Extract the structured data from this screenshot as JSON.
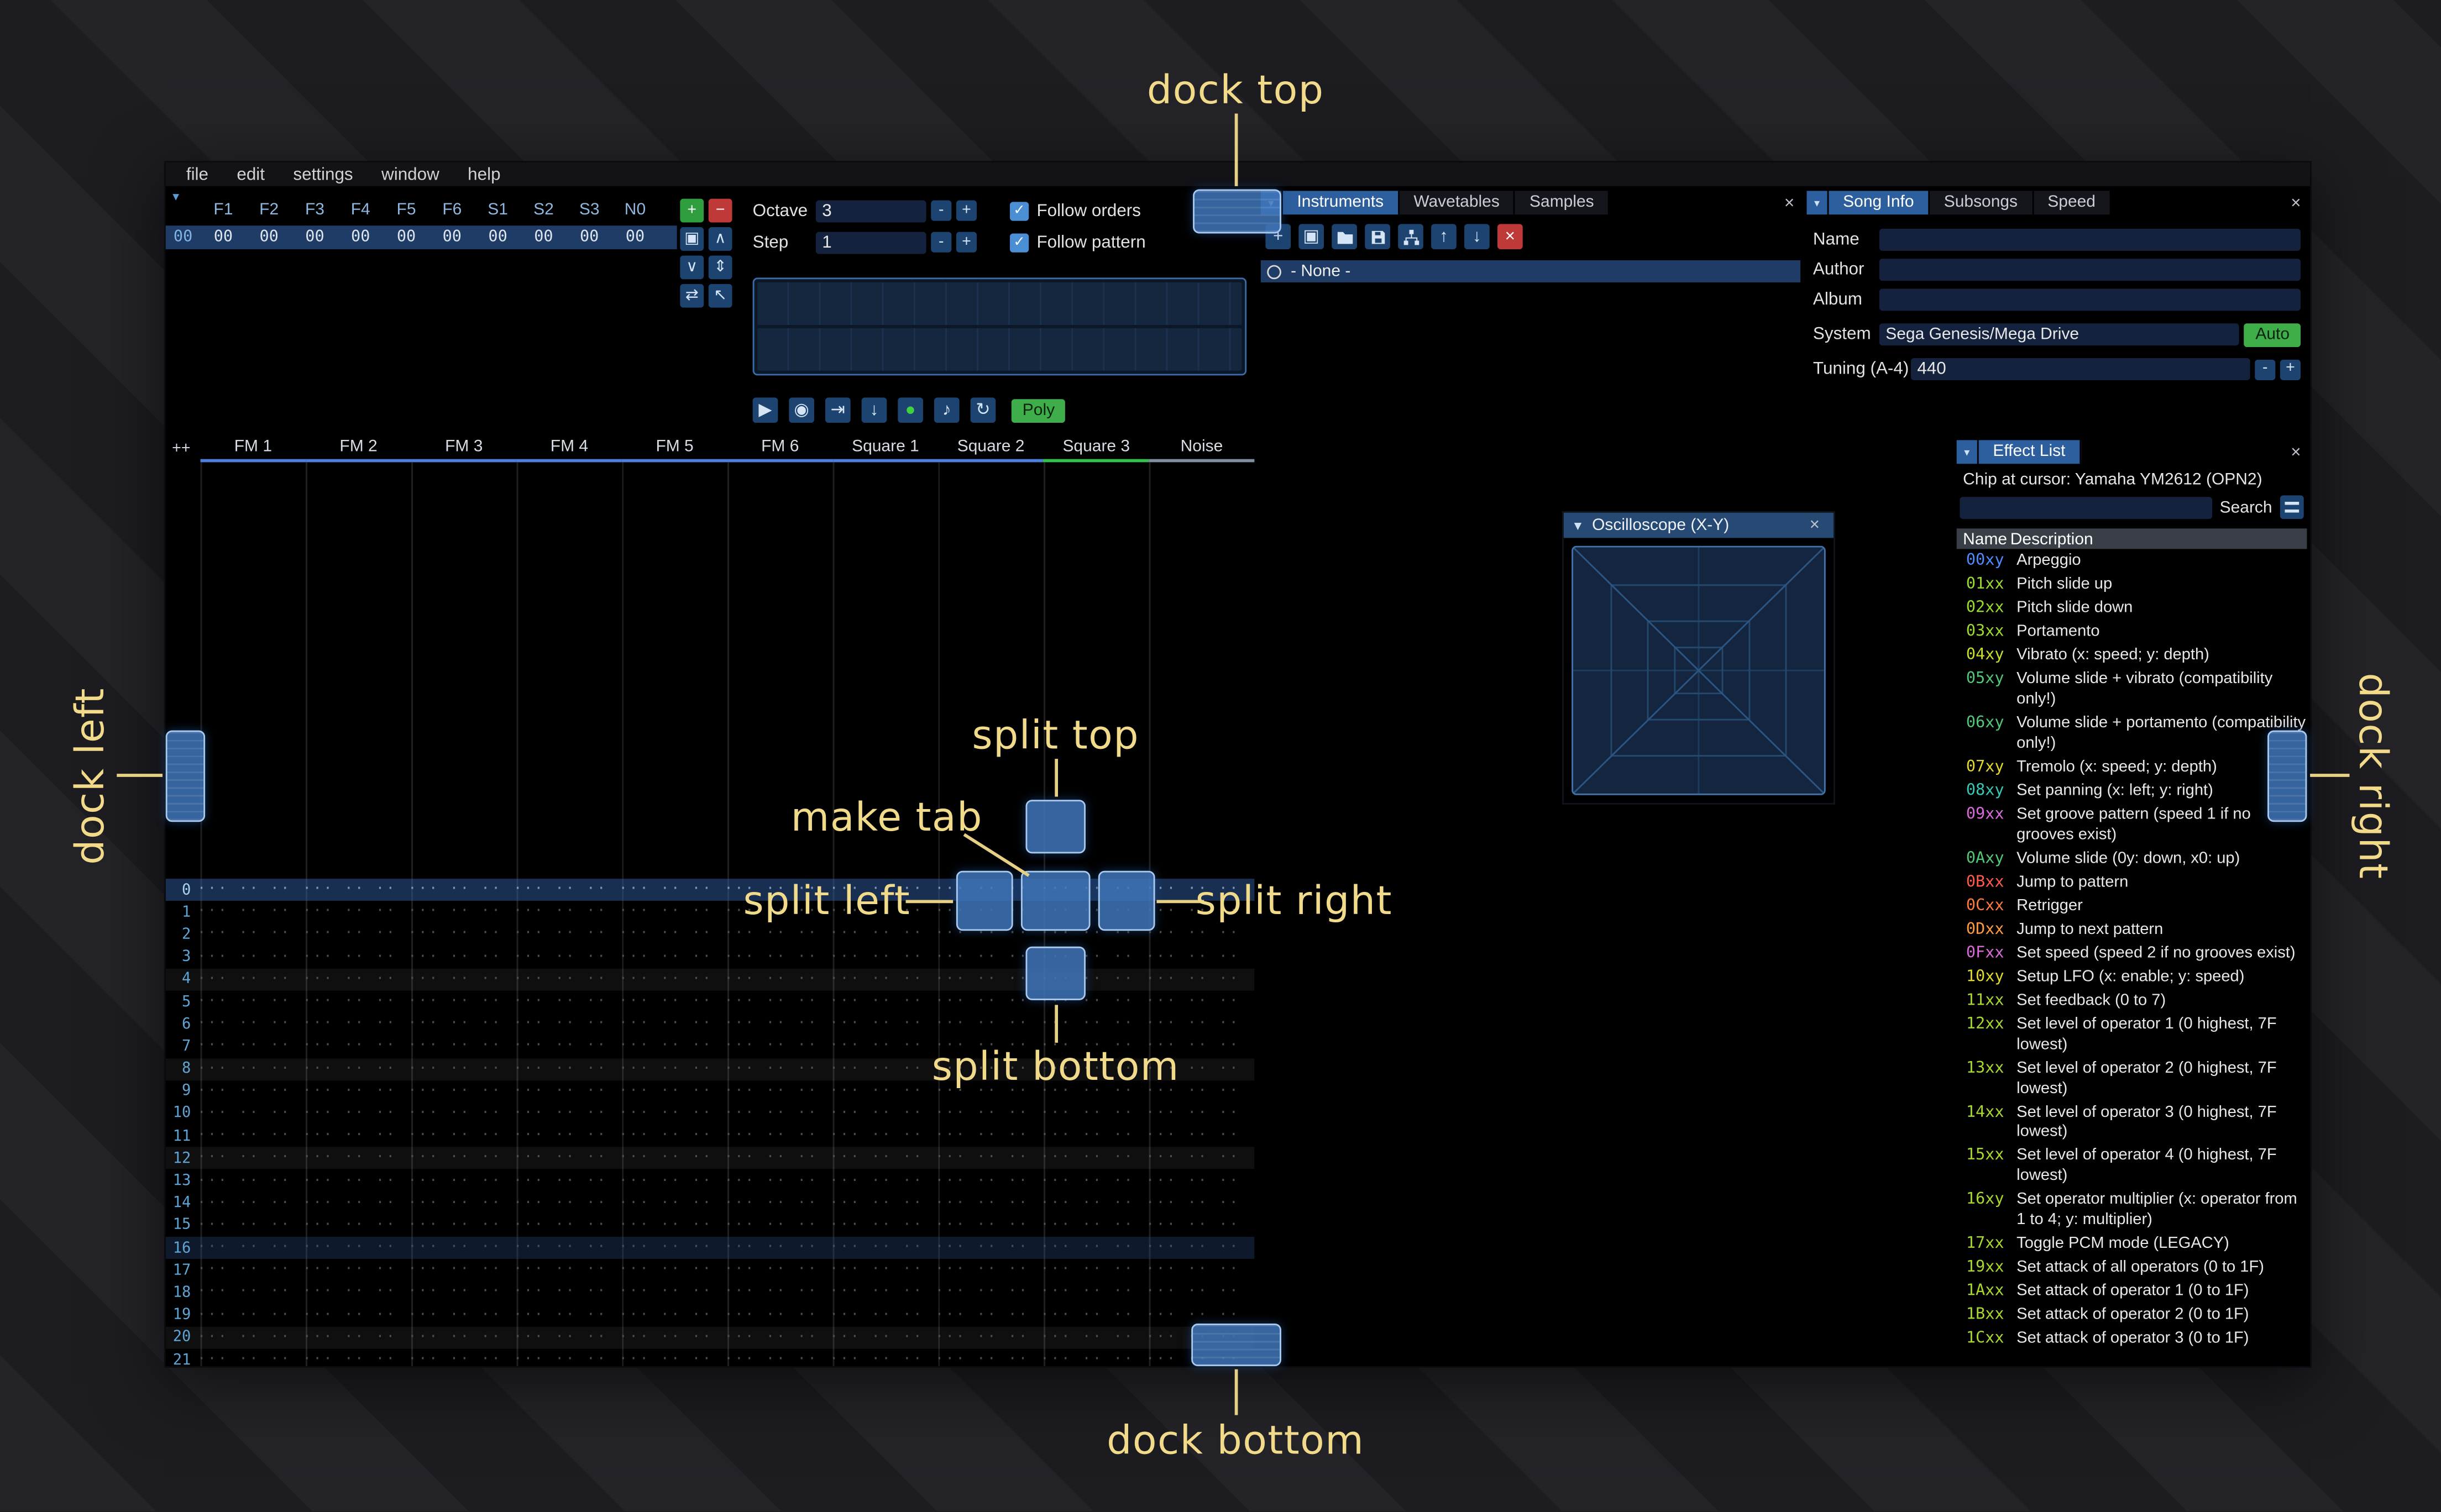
{
  "icons": {
    "close": "×",
    "collapse": "▼",
    "menu": "▾",
    "check": "✓",
    "plus": "+",
    "minus": "-"
  },
  "menu": {
    "items": [
      {
        "label": "file"
      },
      {
        "label": "edit"
      },
      {
        "label": "settings"
      },
      {
        "label": "window"
      },
      {
        "label": "help"
      }
    ]
  },
  "orders": {
    "channels": [
      "F1",
      "F2",
      "F3",
      "F4",
      "F5",
      "F6",
      "S1",
      "S2",
      "S3",
      "N0"
    ],
    "rows": [
      {
        "num": "00",
        "values": [
          "00",
          "00",
          "00",
          "00",
          "00",
          "00",
          "00",
          "00",
          "00",
          "00"
        ],
        "selected": true
      }
    ],
    "buttons": [
      {
        "name": "add-order",
        "glyph": "+",
        "style": "green"
      },
      {
        "name": "remove-order",
        "glyph": "−",
        "style": "red"
      },
      {
        "name": "duplicate-order",
        "glyph": "▣",
        "style": "blue"
      },
      {
        "name": "move-order-up",
        "glyph": "∧",
        "style": "blue"
      },
      {
        "name": "move-order-down",
        "glyph": "∨",
        "style": "blue"
      },
      {
        "name": "order-change-all",
        "glyph": "⇕",
        "style": "blue"
      },
      {
        "name": "order-deep-clone",
        "glyph": "⇄",
        "style": "blue"
      },
      {
        "name": "order-edit-mode",
        "glyph": "↖",
        "style": "blue"
      }
    ]
  },
  "play_controls": {
    "octave_label": "Octave",
    "octave_value": "3",
    "step_label": "Step",
    "step_value": "1",
    "follow_orders_label": "Follow orders",
    "follow_orders_checked": true,
    "follow_pattern_label": "Follow pattern",
    "follow_pattern_checked": true,
    "buttons": [
      {
        "name": "play",
        "glyph": "▶"
      },
      {
        "name": "play-from-start",
        "glyph": "◉"
      },
      {
        "name": "play-one-row",
        "glyph": "⇥"
      },
      {
        "name": "step-row",
        "glyph": "↓"
      },
      {
        "name": "edit-toggle",
        "glyph": "●",
        "style": "record"
      },
      {
        "name": "metronome",
        "glyph": "♪"
      },
      {
        "name": "repeat-pattern",
        "glyph": "↻"
      }
    ],
    "poly_label": "Poly"
  },
  "instruments": {
    "tabs": [
      {
        "label": "Instruments",
        "selected": true
      },
      {
        "label": "Wavetables",
        "selected": false
      },
      {
        "label": "Samples",
        "selected": false
      }
    ],
    "toolbar": [
      {
        "name": "add-instrument",
        "glyph": "+",
        "style": "blue"
      },
      {
        "name": "duplicate-instrument",
        "glyph": "▣",
        "style": "blue"
      },
      {
        "name": "open-instrument",
        "icon": "folder",
        "style": "blue"
      },
      {
        "name": "save-instrument",
        "icon": "floppy",
        "style": "blue"
      },
      {
        "name": "instrument-organizer",
        "icon": "sitemap",
        "style": "blue"
      },
      {
        "name": "move-instrument-up",
        "glyph": "↑",
        "style": "blue"
      },
      {
        "name": "move-instrument-down",
        "glyph": "↓",
        "style": "blue"
      },
      {
        "name": "delete-instrument",
        "glyph": "×",
        "style": "red"
      }
    ],
    "list": [
      {
        "label": "- None -",
        "selected": true
      }
    ]
  },
  "song_info": {
    "tabs": [
      {
        "label": "Song Info",
        "selected": true
      },
      {
        "label": "Subsongs",
        "selected": false
      },
      {
        "label": "Speed",
        "selected": false
      }
    ],
    "name_label": "Name",
    "name_value": "",
    "author_label": "Author",
    "author_value": "",
    "album_label": "Album",
    "album_value": "",
    "system_label": "System",
    "system_value": "Sega Genesis/Mega Drive",
    "auto_label": "Auto",
    "tuning_label": "Tuning (A-4)",
    "tuning_value": "440"
  },
  "pattern": {
    "corner_label": "++",
    "channels": [
      {
        "name": "FM 1",
        "color": "#4d7fe0"
      },
      {
        "name": "FM 2",
        "color": "#4d7fe0"
      },
      {
        "name": "FM 3",
        "color": "#4d7fe0"
      },
      {
        "name": "FM 4",
        "color": "#4d7fe0"
      },
      {
        "name": "FM 5",
        "color": "#4d7fe0"
      },
      {
        "name": "FM 6",
        "color": "#4d7fe0"
      },
      {
        "name": "Square 1",
        "color": "#4d7fe0"
      },
      {
        "name": "Square 2",
        "color": "#4d7fe0"
      },
      {
        "name": "Square 3",
        "color": "#35c04d"
      },
      {
        "name": "Noise",
        "color": "#7f8ea0"
      }
    ],
    "row_count": 22,
    "cell_placeholder": "··· ·· ·· ····"
  },
  "oscilloscope": {
    "title": "Oscilloscope (X-Y)"
  },
  "effect_list": {
    "tab_label": "Effect List",
    "chip_label": "Chip at cursor: Yamaha YM2612 (OPN2)",
    "search_label": "Search",
    "columns": {
      "name": "Name",
      "description": "Description"
    },
    "rows": [
      {
        "code": "00xy",
        "color": "#4e8bff",
        "desc": "Arpeggio"
      },
      {
        "code": "01xx",
        "color": "#9bdc2a",
        "desc": "Pitch slide up"
      },
      {
        "code": "02xx",
        "color": "#9bdc2a",
        "desc": "Pitch slide down"
      },
      {
        "code": "03xx",
        "color": "#9bdc2a",
        "desc": "Portamento"
      },
      {
        "code": "04xy",
        "color": "#c8dc2a",
        "desc": "Vibrato (x: speed; y: depth)"
      },
      {
        "code": "05xy",
        "color": "#51c878",
        "desc": "Volume slide + vibrato (compatibility only!)"
      },
      {
        "code": "06xy",
        "color": "#51c878",
        "desc": "Volume slide + portamento (compatibility only!)"
      },
      {
        "code": "07xy",
        "color": "#e0d82a",
        "desc": "Tremolo (x: speed; y: depth)"
      },
      {
        "code": "08xy",
        "color": "#35c8b4",
        "desc": "Set panning (x: left; y: right)"
      },
      {
        "code": "09xx",
        "color": "#d96ad9",
        "desc": "Set groove pattern (speed 1 if no grooves exist)"
      },
      {
        "code": "0Axy",
        "color": "#51c878",
        "desc": "Volume slide (0y: down, x0: up)"
      },
      {
        "code": "0Bxx",
        "color": "#ff5a4a",
        "desc": "Jump to pattern"
      },
      {
        "code": "0Cxx",
        "color": "#ff7a3a",
        "desc": "Retrigger"
      },
      {
        "code": "0Dxx",
        "color": "#ff9a3a",
        "desc": "Jump to next pattern"
      },
      {
        "code": "0Fxx",
        "color": "#d96ad9",
        "desc": "Set speed (speed 2 if no grooves exist)"
      },
      {
        "code": "10xy",
        "color": "#e0d82a",
        "desc": "Setup LFO (x: enable; y: speed)"
      },
      {
        "code": "11xx",
        "color": "#a8d82a",
        "desc": "Set feedback (0 to 7)"
      },
      {
        "code": "12xx",
        "color": "#a8d82a",
        "desc": "Set level of operator 1 (0 highest, 7F lowest)"
      },
      {
        "code": "13xx",
        "color": "#a8d82a",
        "desc": "Set level of operator 2 (0 highest, 7F lowest)"
      },
      {
        "code": "14xx",
        "color": "#a8d82a",
        "desc": "Set level of operator 3 (0 highest, 7F lowest)"
      },
      {
        "code": "15xx",
        "color": "#a8d82a",
        "desc": "Set level of operator 4 (0 highest, 7F lowest)"
      },
      {
        "code": "16xy",
        "color": "#a8d82a",
        "desc": "Set operator multiplier (x: operator from 1 to 4; y: multiplier)"
      },
      {
        "code": "17xx",
        "color": "#a8d82a",
        "desc": "Toggle PCM mode (LEGACY)"
      },
      {
        "code": "19xx",
        "color": "#a8d82a",
        "desc": "Set attack of all operators (0 to 1F)"
      },
      {
        "code": "1Axx",
        "color": "#a8d82a",
        "desc": "Set attack of operator 1 (0 to 1F)"
      },
      {
        "code": "1Bxx",
        "color": "#a8d82a",
        "desc": "Set attack of operator 2 (0 to 1F)"
      },
      {
        "code": "1Cxx",
        "color": "#a8d82a",
        "desc": "Set attack of operator 3 (0 to 1F)"
      }
    ]
  },
  "annotations": {
    "dock_top": "dock top",
    "dock_bottom": "dock bottom",
    "dock_left": "dock left",
    "dock_right": "dock right",
    "split_top": "split top",
    "split_bottom": "split bottom",
    "split_left": "split left",
    "split_right": "split right",
    "make_tab": "make tab",
    "label_color": "#f1da8a",
    "indicator_fill": "#3e75b8"
  }
}
